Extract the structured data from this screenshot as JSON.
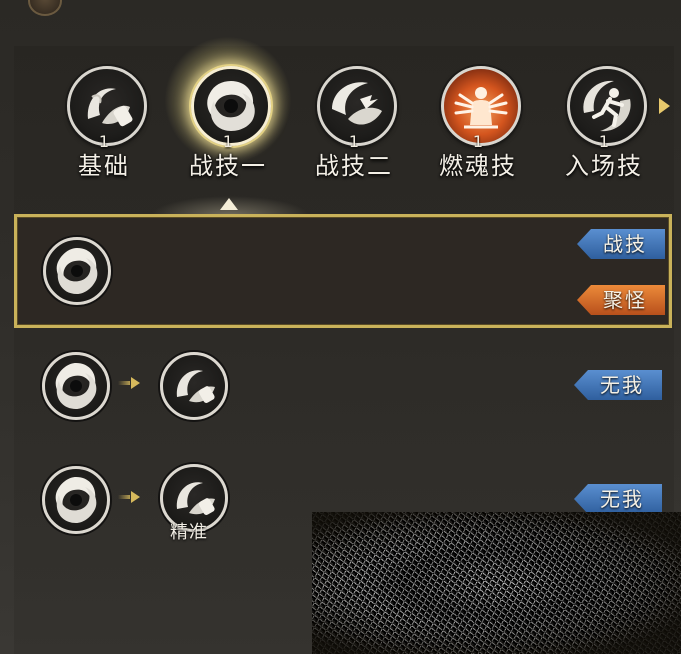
{
  "tabs": [
    {
      "label": "基础",
      "count": "1",
      "icon": "fist-swirl-icon",
      "active": false
    },
    {
      "label": "战技一",
      "count": "1",
      "icon": "vortex-icon",
      "active": true
    },
    {
      "label": "战技二",
      "count": "1",
      "icon": "hand-swirl-icon",
      "active": false
    },
    {
      "label": "燃魂技",
      "count": "1",
      "icon": "multi-arm-deity-icon",
      "active": false
    },
    {
      "label": "入场技",
      "count": "1",
      "icon": "figure-leap-icon",
      "active": false
    }
  ],
  "combos": [
    {
      "tags": [
        "战技",
        "聚怪"
      ],
      "sublabel": ""
    },
    {
      "tags": [
        "无我"
      ],
      "sublabel": ""
    },
    {
      "tags": [
        "无我"
      ],
      "sublabel": "精准"
    }
  ],
  "colors": {
    "tag_blue": "#3a70b4",
    "tag_orange": "#d0672a",
    "selected_border": "#c9b25a"
  }
}
